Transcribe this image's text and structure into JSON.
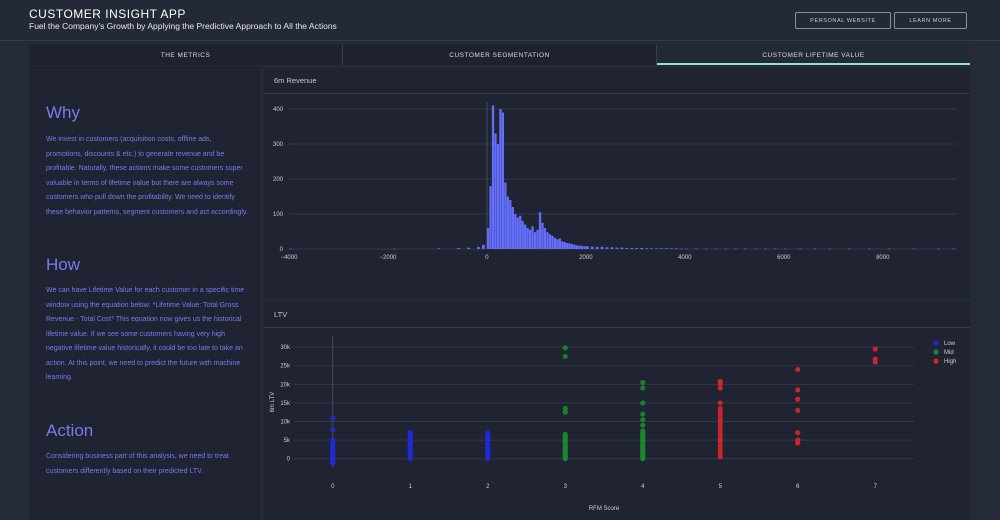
{
  "header": {
    "title": "CUSTOMER INSIGHT APP",
    "subtitle": "Fuel the Company's Growth by Applying the Predictive Approach to All the Actions",
    "buttons": {
      "website": "PERSONAL WEBSITE",
      "learn": "LEARN MORE"
    }
  },
  "tabs": [
    {
      "label": "THE METRICS"
    },
    {
      "label": "CUSTOMER SEGMENTATION"
    },
    {
      "label": "CUSTOMER LIFETIME VALUE"
    }
  ],
  "sidebar": {
    "why_heading": "Why",
    "why_text": "We invest in customers (acquisition costs, offline ads, promotions, discounts & etc.) to generate revenue and be profitable. Naturally, these actions make some customers super valuable in terms of lifetime value but there are always some customers who pull down the profitability. We need to identify these behavior patterns, segment customers and act accordingly.",
    "how_heading": "How",
    "how_text": "We can have Lifetime Value for each customer in a specific time window using the equation below: *Lifetime Value: Total Gross Revenue - Total Cost* This equation now gives us the historical lifetime value. If we see some customers having very high negative lifetime value historically, it could be too late to take an action. At this point, we need to predict the future with machine learning.",
    "action_heading": "Action",
    "action_text": "Considering business part of this analysis, we need to treat customers differently based on their predicted LTV."
  },
  "colors": {
    "accent": "#8ee3d8",
    "text_purple": "#7b79f0",
    "bar": "#636efa"
  },
  "chart_data": [
    {
      "type": "bar",
      "title": "6m Revenue",
      "xlim": [
        -4000,
        9500
      ],
      "ylim": [
        0,
        420
      ],
      "xticks": [
        "−4000",
        "−2000",
        "0",
        "2000",
        "4000",
        "6000",
        "8000"
      ],
      "yticks": [
        "0",
        "100",
        "200",
        "300",
        "400"
      ],
      "bins": [
        [
          -4000,
          1
        ],
        [
          -1900,
          1
        ],
        [
          -1000,
          2
        ],
        [
          -600,
          3
        ],
        [
          -400,
          4
        ],
        [
          -200,
          6
        ],
        [
          -100,
          12
        ],
        [
          0,
          60
        ],
        [
          50,
          180
        ],
        [
          100,
          410
        ],
        [
          150,
          330
        ],
        [
          200,
          300
        ],
        [
          250,
          400
        ],
        [
          300,
          390
        ],
        [
          350,
          190
        ],
        [
          400,
          150
        ],
        [
          450,
          140
        ],
        [
          500,
          120
        ],
        [
          550,
          100
        ],
        [
          600,
          90
        ],
        [
          650,
          95
        ],
        [
          700,
          80
        ],
        [
          750,
          70
        ],
        [
          800,
          60
        ],
        [
          850,
          55
        ],
        [
          900,
          65
        ],
        [
          950,
          48
        ],
        [
          1000,
          55
        ],
        [
          1050,
          105
        ],
        [
          1100,
          75
        ],
        [
          1150,
          60
        ],
        [
          1200,
          48
        ],
        [
          1250,
          42
        ],
        [
          1300,
          38
        ],
        [
          1350,
          32
        ],
        [
          1400,
          28
        ],
        [
          1450,
          30
        ],
        [
          1500,
          22
        ],
        [
          1550,
          20
        ],
        [
          1600,
          17
        ],
        [
          1650,
          16
        ],
        [
          1700,
          14
        ],
        [
          1750,
          12
        ],
        [
          1800,
          10
        ],
        [
          1850,
          10
        ],
        [
          1900,
          9
        ],
        [
          1950,
          8
        ],
        [
          2000,
          8
        ],
        [
          2100,
          7
        ],
        [
          2200,
          6
        ],
        [
          2300,
          6
        ],
        [
          2400,
          5
        ],
        [
          2500,
          5
        ],
        [
          2600,
          4
        ],
        [
          2700,
          4
        ],
        [
          2800,
          3
        ],
        [
          2900,
          3
        ],
        [
          3000,
          3
        ],
        [
          3100,
          3
        ],
        [
          3200,
          2
        ],
        [
          3300,
          2
        ],
        [
          3400,
          2
        ],
        [
          3500,
          2
        ],
        [
          3600,
          2
        ],
        [
          3700,
          2
        ],
        [
          3800,
          2
        ],
        [
          3900,
          1
        ],
        [
          4000,
          1
        ],
        [
          4200,
          1
        ],
        [
          4400,
          1
        ],
        [
          4600,
          1
        ],
        [
          4800,
          1
        ],
        [
          5000,
          1
        ],
        [
          5200,
          1
        ],
        [
          5400,
          1
        ],
        [
          5600,
          1
        ],
        [
          5800,
          1
        ],
        [
          6000,
          1
        ],
        [
          6300,
          1
        ],
        [
          6600,
          1
        ],
        [
          6900,
          1
        ],
        [
          7300,
          1
        ],
        [
          7700,
          1
        ],
        [
          8100,
          1
        ],
        [
          8600,
          1
        ],
        [
          9100,
          1
        ],
        [
          9400,
          1
        ]
      ]
    },
    {
      "type": "scatter",
      "title": "LTV",
      "xlabel": "RFM Score",
      "ylabel": "6m LTV",
      "xlim": [
        -0.5,
        7.5
      ],
      "ylim": [
        -2500,
        33000
      ],
      "xticks": [
        "0",
        "1",
        "2",
        "3",
        "4",
        "5",
        "6",
        "7"
      ],
      "yticks": [
        "0",
        "5k",
        "10k",
        "15k",
        "20k",
        "25k",
        "30k"
      ],
      "legend_position": "top-right",
      "series": [
        {
          "name": "Low",
          "color": "#1f2ad1",
          "points": [
            [
              0,
              0
            ],
            [
              0,
              300
            ],
            [
              0,
              600
            ],
            [
              0,
              900
            ],
            [
              0,
              1200
            ],
            [
              0,
              1500
            ],
            [
              0,
              1800
            ],
            [
              0,
              2100
            ],
            [
              0,
              2400
            ],
            [
              0,
              2800
            ],
            [
              0,
              3200
            ],
            [
              0,
              3600
            ],
            [
              0,
              4000
            ],
            [
              0,
              4400
            ],
            [
              0,
              5000
            ],
            [
              0,
              -400
            ],
            [
              0,
              -800
            ],
            [
              0,
              -1200
            ],
            [
              0,
              11000
            ],
            [
              0,
              7800
            ],
            [
              1,
              0
            ],
            [
              1,
              400
            ],
            [
              1,
              800
            ],
            [
              1,
              1200
            ],
            [
              1,
              1600
            ],
            [
              1,
              2000
            ],
            [
              1,
              2400
            ],
            [
              1,
              2800
            ],
            [
              1,
              3200
            ],
            [
              1,
              3600
            ],
            [
              1,
              4000
            ],
            [
              1,
              4400
            ],
            [
              1,
              4800
            ],
            [
              1,
              5200
            ],
            [
              1,
              5600
            ],
            [
              1,
              6100
            ],
            [
              1,
              6600
            ],
            [
              1,
              7100
            ],
            [
              2,
              0
            ],
            [
              2,
              400
            ],
            [
              2,
              800
            ],
            [
              2,
              1200
            ],
            [
              2,
              1600
            ],
            [
              2,
              2000
            ],
            [
              2,
              2400
            ],
            [
              2,
              2800
            ],
            [
              2,
              3200
            ],
            [
              2,
              3600
            ],
            [
              2,
              4000
            ],
            [
              2,
              4400
            ],
            [
              2,
              4800
            ],
            [
              2,
              5200
            ],
            [
              2,
              5600
            ],
            [
              2,
              6000
            ],
            [
              2,
              6500
            ],
            [
              2,
              7000
            ]
          ]
        },
        {
          "name": "Mid",
          "color": "#1a8a2a",
          "points": [
            [
              3,
              0
            ],
            [
              3,
              500
            ],
            [
              3,
              1000
            ],
            [
              3,
              1500
            ],
            [
              3,
              2000
            ],
            [
              3,
              2500
            ],
            [
              3,
              3000
            ],
            [
              3,
              3500
            ],
            [
              3,
              4000
            ],
            [
              3,
              4500
            ],
            [
              3,
              5000
            ],
            [
              3,
              5500
            ],
            [
              3,
              6000
            ],
            [
              3,
              6500
            ],
            [
              3,
              12500
            ],
            [
              3,
              13500
            ],
            [
              3,
              27500
            ],
            [
              3,
              29800
            ],
            [
              4,
              0
            ],
            [
              4,
              500
            ],
            [
              4,
              1000
            ],
            [
              4,
              1500
            ],
            [
              4,
              2000
            ],
            [
              4,
              2500
            ],
            [
              4,
              3000
            ],
            [
              4,
              3500
            ],
            [
              4,
              4000
            ],
            [
              4,
              4500
            ],
            [
              4,
              5000
            ],
            [
              4,
              5500
            ],
            [
              4,
              6000
            ],
            [
              4,
              6500
            ],
            [
              4,
              7000
            ],
            [
              4,
              7500
            ],
            [
              4,
              9000
            ],
            [
              4,
              10500
            ],
            [
              4,
              12000
            ],
            [
              4,
              15000
            ],
            [
              4,
              19000
            ],
            [
              4,
              20500
            ]
          ]
        },
        {
          "name": "High",
          "color": "#d62728",
          "points": [
            [
              5,
              500
            ],
            [
              5,
              1500
            ],
            [
              5,
              2500
            ],
            [
              5,
              3500
            ],
            [
              5,
              4500
            ],
            [
              5,
              5500
            ],
            [
              5,
              6500
            ],
            [
              5,
              7500
            ],
            [
              5,
              8500
            ],
            [
              5,
              9500
            ],
            [
              5,
              10500
            ],
            [
              5,
              11500
            ],
            [
              5,
              12500
            ],
            [
              5,
              13500
            ],
            [
              5,
              15000
            ],
            [
              5,
              19000
            ],
            [
              5,
              20000
            ],
            [
              5,
              20800
            ],
            [
              6,
              4200
            ],
            [
              6,
              5000
            ],
            [
              6,
              7000
            ],
            [
              6,
              13000
            ],
            [
              6,
              16000
            ],
            [
              6,
              18500
            ],
            [
              6,
              24000
            ],
            [
              7,
              26000
            ],
            [
              7,
              26800
            ],
            [
              7,
              29500
            ]
          ]
        }
      ]
    }
  ]
}
